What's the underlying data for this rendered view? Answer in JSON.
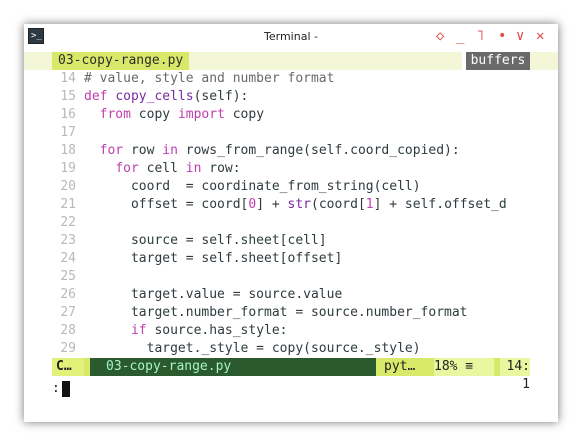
{
  "window": {
    "title": "Terminal -",
    "controls": [
      "◇",
      "_",
      "˥",
      "•",
      "∨",
      "✕"
    ]
  },
  "tabline": {
    "active_tab": "03-copy-range.py",
    "right_label": "buffers"
  },
  "editor": {
    "lines": [
      {
        "n": "14",
        "segments": [
          {
            "t": "# value, style and number format",
            "c": "cm"
          }
        ]
      },
      {
        "n": "15",
        "segments": [
          {
            "t": "def ",
            "c": "kw"
          },
          {
            "t": "copy_cells",
            "c": "fn"
          },
          {
            "t": "(self):"
          }
        ]
      },
      {
        "n": "16",
        "segments": [
          {
            "t": "  "
          },
          {
            "t": "from",
            "c": "kw"
          },
          {
            "t": " copy "
          },
          {
            "t": "import",
            "c": "kw"
          },
          {
            "t": " copy"
          }
        ]
      },
      {
        "n": "17",
        "segments": []
      },
      {
        "n": "18",
        "segments": [
          {
            "t": "  "
          },
          {
            "t": "for",
            "c": "kw"
          },
          {
            "t": " row "
          },
          {
            "t": "in",
            "c": "kw"
          },
          {
            "t": " rows_from_range(self.coord_copied):"
          }
        ]
      },
      {
        "n": "19",
        "segments": [
          {
            "t": "    "
          },
          {
            "t": "for",
            "c": "kw"
          },
          {
            "t": " cell "
          },
          {
            "t": "in",
            "c": "kw"
          },
          {
            "t": " row:"
          }
        ]
      },
      {
        "n": "20",
        "segments": [
          {
            "t": "      coord  = coordinate_from_string(cell)"
          }
        ]
      },
      {
        "n": "21",
        "segments": [
          {
            "t": "      offset = coord["
          },
          {
            "t": "0",
            "c": "num"
          },
          {
            "t": "] + "
          },
          {
            "t": "str",
            "c": "fn"
          },
          {
            "t": "(coord["
          },
          {
            "t": "1",
            "c": "num"
          },
          {
            "t": "] + self.offset_d"
          }
        ]
      },
      {
        "n": "22",
        "segments": []
      },
      {
        "n": "23",
        "segments": [
          {
            "t": "      source = self.sheet[cell]"
          }
        ]
      },
      {
        "n": "24",
        "segments": [
          {
            "t": "      target = self.sheet[offset]"
          }
        ]
      },
      {
        "n": "25",
        "segments": []
      },
      {
        "n": "26",
        "segments": [
          {
            "t": "      target.value = source.value"
          }
        ]
      },
      {
        "n": "27",
        "segments": [
          {
            "t": "      target.number_format = source.number_format"
          }
        ]
      },
      {
        "n": "28",
        "segments": [
          {
            "t": "      "
          },
          {
            "t": "if",
            "c": "kw"
          },
          {
            "t": " source.has_style:"
          }
        ]
      },
      {
        "n": "29",
        "segments": [
          {
            "t": "        target._style = copy(source._style)"
          }
        ]
      }
    ]
  },
  "statusline": {
    "mode": "C…",
    "filename": "03-copy-range.py",
    "filetype": "pyt…",
    "percent": "18% ≡",
    "position": "14:  1"
  },
  "cmdline": {
    "prompt": ":"
  },
  "colors": {
    "accent": "#d8e96a",
    "keyword": "#c03dae",
    "function": "#7b2ba5"
  }
}
